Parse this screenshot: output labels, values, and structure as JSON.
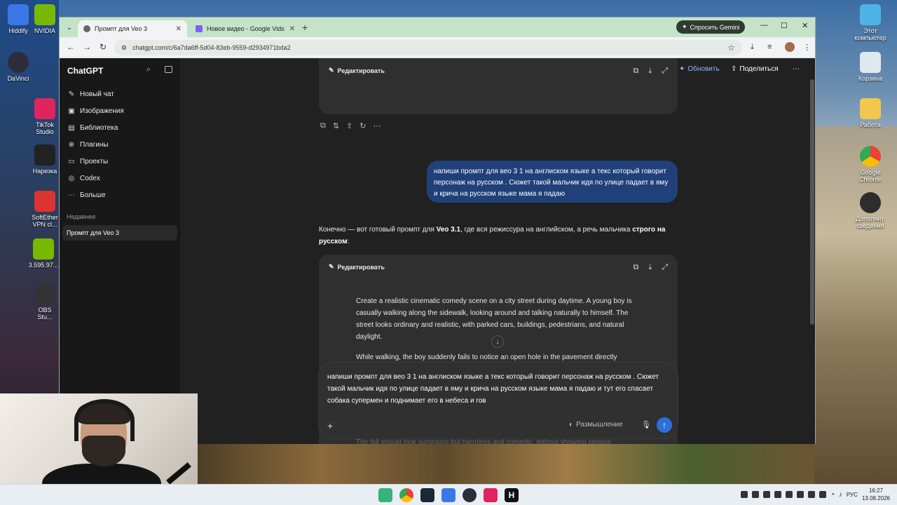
{
  "desktop": {
    "left_icons": [
      {
        "label": "Hiddify"
      },
      {
        "label": "NVIDIA"
      },
      {
        "label": "DaVinci"
      },
      {
        "label": "TikTok Studio"
      },
      {
        "label": "Нарезка"
      },
      {
        "label": "SoftEther VPN cl..."
      },
      {
        "label": "3.595.97..."
      },
      {
        "label": "OBS Stu..."
      }
    ],
    "right_icons": [
      {
        "label": "Этот компьютер"
      },
      {
        "label": "Корзина"
      },
      {
        "label": "Работа"
      },
      {
        "label": "Google Chrome"
      },
      {
        "label": "Дополнит. сведения"
      }
    ]
  },
  "browser": {
    "tabs": [
      {
        "title": "Промпт для Veo 3",
        "active": true
      },
      {
        "title": "Новое видео - Google Vids",
        "active": false
      }
    ],
    "new_tab": "+",
    "gemini_button": "Спросить Gemini",
    "url": "chatgpt.com/c/6a7da6ff-5d04-83eb-9559-d2934971bda2"
  },
  "sidebar": {
    "brand": "ChatGPT",
    "items": [
      {
        "label": "Новый чат",
        "icon": "edit-icon"
      },
      {
        "label": "Изображения",
        "icon": "image-icon"
      },
      {
        "label": "Библиотека",
        "icon": "library-icon"
      },
      {
        "label": "Плагины",
        "icon": "plugin-icon"
      },
      {
        "label": "Проекты",
        "icon": "folder-icon"
      },
      {
        "label": "Codex",
        "icon": "codex-icon"
      },
      {
        "label": "Больше",
        "icon": "more-icon"
      }
    ],
    "section_label": "Недавнее",
    "recent_chats": [
      "Промпт для Veo 3"
    ]
  },
  "topbar": {
    "upgrade": "Обновить",
    "share": "Поделиться",
    "more": "⋯"
  },
  "chat": {
    "edit_label": "Редактировать",
    "user_message": "напиши промпт для вео 3 1 на англиском языке а текс который говорит персонаж на русском . Сюжет такой мальчик идя по улице падает в яму и крича на русском языке мама я падаю",
    "answer_intro_part1": "Конечно — вот готовый промпт для ",
    "answer_intro_bold1": "Veo 3.1",
    "answer_intro_part2": ", где вся режиссура на английском, а речь мальчика ",
    "answer_intro_bold2": "строго на русском",
    "answer_intro_part3": ":",
    "code_paragraph_1": "Create a realistic cinematic comedy scene on a city street during daytime. A young boy is casually walking along the sidewalk, looking around and talking naturally to himself. The street looks ordinary and realistic, with parked cars, buildings, pedestrians, and natural daylight.",
    "code_paragraph_2": "While walking, the boy suddenly fails to notice an open hole in the pavement directly",
    "code_faded": "The fall should look surprising but harmless and comedic, without showing serious"
  },
  "composer": {
    "text": "напиши промпт для вео 3 1 на англиском языке а текс который говорит персонаж на русском . Сюжет такой мальчик идя по улице падает в яму и крича на русском языке мама я падаю и тут его спасает собака супермен и поднимает его в небеса и гов",
    "think_label": "Размышление"
  },
  "taskbar": {
    "lang": "РУС",
    "time": "16:27",
    "date": "13.08.2026"
  }
}
